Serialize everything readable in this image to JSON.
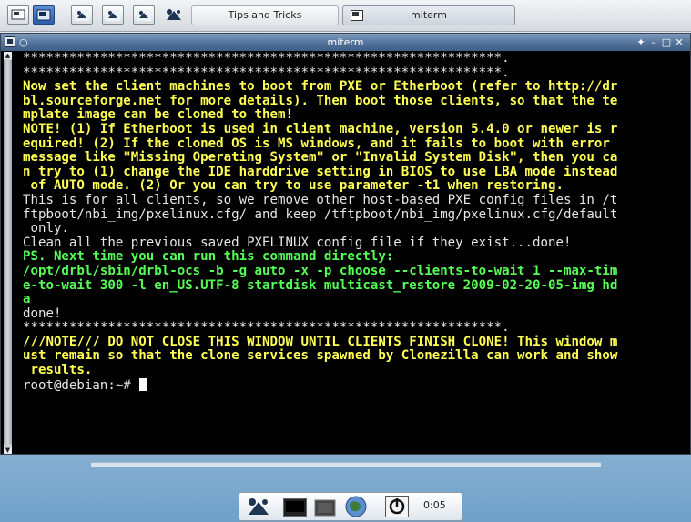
{
  "taskbar": {
    "launchers": [
      "show-desktop-icon",
      "terminal-icon",
      "xfce-mouse-icon",
      "xfce-mouse-icon",
      "xfce-mouse-icon"
    ],
    "tasks": [
      {
        "label": "Tips and Tricks",
        "icon": "xfce-mouse-icon"
      },
      {
        "label": "miterm",
        "icon": "terminal-icon"
      }
    ]
  },
  "window": {
    "title": "miterm",
    "controls": [
      "✦",
      "–",
      "□",
      "✕"
    ],
    "lines": [
      {
        "style": "w",
        "text": "**************************************************************."
      },
      {
        "style": "w",
        "text": "**************************************************************."
      },
      {
        "style": "yb",
        "text": "Now set the client machines to boot from PXE or Etherboot (refer to http://dr"
      },
      {
        "style": "yb",
        "text": "bl.sourceforge.net for more details). Then boot those clients, so that the te"
      },
      {
        "style": "yb",
        "text": "mplate image can be cloned to them!"
      },
      {
        "style": "yb",
        "text": "NOTE! (1) If Etherboot is used in client machine, version 5.4.0 or newer is r"
      },
      {
        "style": "yb",
        "text": "equired! (2) If the cloned OS is MS windows, and it fails to boot with error"
      },
      {
        "style": "yb",
        "text": "message like \"Missing Operating System\" or \"Invalid System Disk\", then you ca"
      },
      {
        "style": "yb",
        "text": "n try to (1) change the IDE harddrive setting in BIOS to use LBA mode instead"
      },
      {
        "style": "yb",
        "text": " of AUTO mode. (2) Or you can try to use parameter -t1 when restoring."
      },
      {
        "style": "w",
        "text": "This is for all clients, so we remove other host-based PXE config files in /t"
      },
      {
        "style": "w",
        "text": "ftpboot/nbi_img/pxelinux.cfg/ and keep /tftpboot/nbi_img/pxelinux.cfg/default"
      },
      {
        "style": "w",
        "text": " only."
      },
      {
        "style": "w",
        "text": "Clean all the previous saved PXELINUX config file if they exist...done!"
      },
      {
        "style": "gb",
        "text": "PS. Next time you can run this command directly:"
      },
      {
        "style": "gb",
        "text": "/opt/drbl/sbin/drbl-ocs -b -g auto -x -p choose --clients-to-wait 1 --max-tim"
      },
      {
        "style": "gb",
        "text": "e-to-wait 300 -l en_US.UTF-8 startdisk multicast_restore 2009-02-20-05-img hd"
      },
      {
        "style": "gb",
        "text": "a"
      },
      {
        "style": "w",
        "text": "done!"
      },
      {
        "style": "w",
        "text": "**************************************************************."
      },
      {
        "style": "yb",
        "text": "///NOTE/// DO NOT CLOSE THIS WINDOW UNTIL CLIENTS FINISH CLONE! This window m"
      },
      {
        "style": "yb",
        "text": "ust remain so that the clone services spawned by Clonezilla can work and show"
      },
      {
        "style": "yb",
        "text": " results."
      },
      {
        "style": "w",
        "text": "root@debian:~# "
      }
    ]
  },
  "dock": {
    "icons": [
      "xfce-mouse-icon",
      "terminal-icon",
      "file-manager-icon",
      "web-browser-icon",
      "power-icon"
    ],
    "clock": "0:05"
  },
  "colors": {
    "terminal_bg": "#000000",
    "bold_yellow": "#ffff54",
    "bold_green": "#55ff55",
    "normal_text": "#e6e6e6",
    "titlebar": "#4f6f97"
  }
}
